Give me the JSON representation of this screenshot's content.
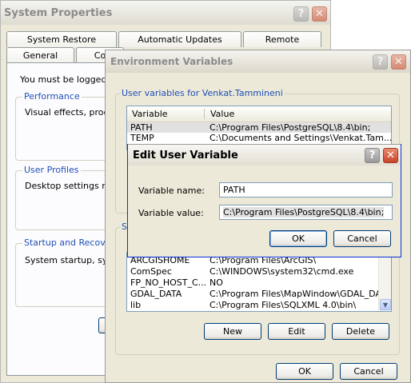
{
  "system_properties": {
    "title": "System Properties",
    "tabs_top": [
      "System Restore",
      "Automatic Updates",
      "Remote"
    ],
    "tabs_bottom": [
      "General",
      "Co"
    ],
    "notice": "You must be logged on",
    "performance": {
      "label": "Performance",
      "text": "Visual effects, proces"
    },
    "user_profiles": {
      "label": "User Profiles",
      "text": "Desktop settings rela"
    },
    "startup": {
      "label": "Startup and Recovery",
      "text": "System startup, syste"
    }
  },
  "env_vars": {
    "title": "Environment Variables",
    "user_group_label": "User variables for Venkat.Tammineni",
    "columns": {
      "variable": "Variable",
      "value": "Value"
    },
    "user_rows": [
      {
        "variable": "PATH",
        "value": "C:\\Program Files\\PostgreSQL\\8.4\\bin;"
      },
      {
        "variable": "TEMP",
        "value": "C:\\Documents and Settings\\Venkat.Tam..."
      }
    ],
    "system_group_label": "S",
    "system_rows": [
      {
        "variable": "ARCGISHOME",
        "value": "C:\\Program Files\\ArcGIS\\"
      },
      {
        "variable": "ComSpec",
        "value": "C:\\WINDOWS\\system32\\cmd.exe"
      },
      {
        "variable": "FP_NO_HOST_C...",
        "value": "NO"
      },
      {
        "variable": "GDAL_DATA",
        "value": "C:\\Program Files\\MapWindow\\GDAL_DATA"
      },
      {
        "variable": "lib",
        "value": "C:\\Program Files\\SQLXML 4.0\\bin\\"
      }
    ],
    "new_label": "New",
    "edit_label": "Edit",
    "delete_label": "Delete",
    "ok_label": "OK",
    "cancel_label": "Cancel"
  },
  "edit_dialog": {
    "title": "Edit User Variable",
    "name_label": "Variable name:",
    "name_value": "PATH",
    "value_label": "Variable value:",
    "value_value": "C:\\Program Files\\PostgreSQL\\8.4\\bin;",
    "ok_label": "OK",
    "cancel_label": "Cancel"
  },
  "icons": {
    "help": "?",
    "close": "✕",
    "scroll_down": "▼",
    "scroll_up": "▲"
  },
  "colors": {
    "group_label": "#1f4fb9",
    "selection": "#e1e1e1",
    "title_active": "#0a246a"
  }
}
